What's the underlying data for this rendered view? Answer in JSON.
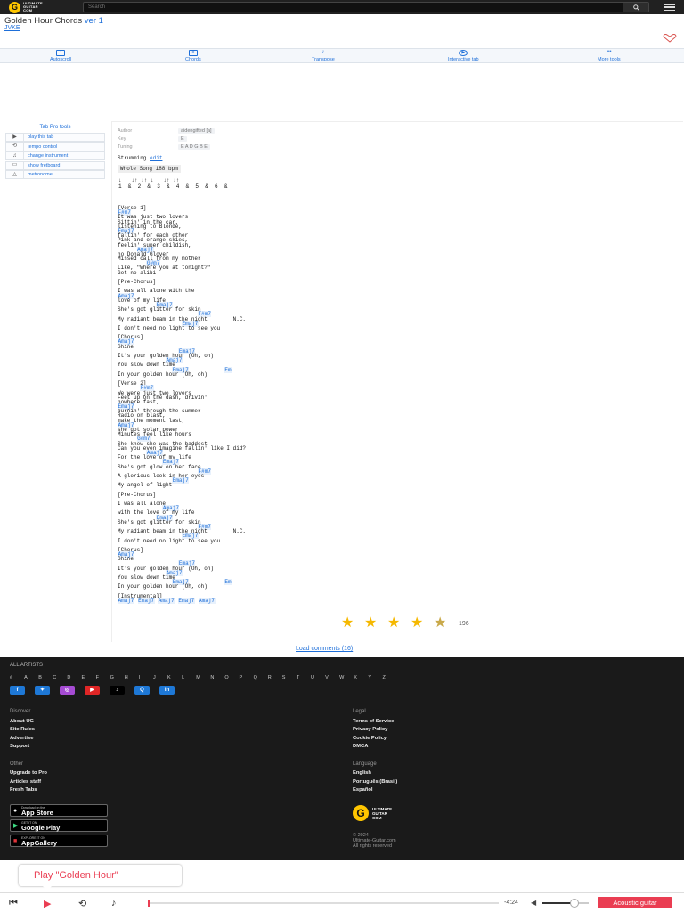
{
  "header": {
    "logo_lines": [
      "ULTIMATE",
      "GUITAR",
      "COM"
    ],
    "search_placeholder": "Search"
  },
  "song": {
    "title": "Golden Hour Chords",
    "version": "ver 1",
    "artist": "JVKE"
  },
  "toolbar": [
    "Autoscroll",
    "Chords",
    "Transpose",
    "Interactive tab",
    "More tools"
  ],
  "side_tools": {
    "header": "Tab Pro tools",
    "items": [
      "play this tab",
      "tempo control",
      "change instrument",
      "show fretboard",
      "metronome"
    ]
  },
  "meta": {
    "author_label": "Author",
    "author": "aidengifted [a]",
    "key_label": "Key",
    "key": "E",
    "tuning_label": "Tuning",
    "tuning": "E A D G B E"
  },
  "strumming": {
    "label": "Strumming",
    "edit": "edit",
    "pattern": "Whole Song   188 bpm",
    "counts": "1  &  2  &  3  &  4  &  5  &  6  &"
  },
  "tab_lines": [
    "[Verse 1]",
    "{F#m7}",
    "It was just two lovers",
    "Sittin' in the car,",
    "listening to Blonde,",
    "{Emaj7}",
    "fallin' for each other",
    "Pink and orange skies,",
    "feelin' super childish,",
    "      {Amaj7}",
    "no Donald Glover",
    "Missed call from my mother",
    "         {G#m7}",
    "Like, \"Where you at tonight?\"",
    "Got no alibi",
    "",
    "[Pre-Chorus]",
    "",
    "I was all alone with the",
    "{Amaj7}",
    "love of my life",
    "            {Emaj7}",
    "She's got glitter for skin",
    "                         {F#m7}",
    "My radiant beam in the night        N.C.",
    "                    {Emaj7}",
    "I don't need no light to see you",
    "",
    "[Chorus]",
    "{Amaj7}",
    "Shine",
    "                   {Emaj7}",
    "It's your golden hour (Oh, oh)",
    "               {Amaj7}",
    "You slow down time",
    "                 {Emaj7}           {Em}",
    "In your golden hour (Oh, oh)",
    "",
    "[Verse 2]",
    "       {F#m7}",
    "We were just two lovers",
    "Feet up on the dash, drivin'",
    "nowhere fast,",
    "{Emaj7}",
    "burnin' through the summer",
    "Radio on blast,",
    "make the moment last,",
    "{Amaj7}",
    "she got solar power",
    "Minutes feel like hours",
    "      {G#m7}",
    "She knew she was the baddest",
    "Can you even imagine fallin' like I did?",
    "         {Amaj7}",
    "For the love of my life",
    "              {Emaj7}",
    "She's got glow on her face",
    "                         {F#m7}",
    "A glorious look in her eyes",
    "                 {Emaj7}",
    "My angel of light",
    "",
    "[Pre-Chorus]",
    "",
    "I was all alone",
    "              {Amaj7}",
    "with the love of my life",
    "            {Emaj7}",
    "She's got glitter for skin",
    "                         {F#m7}",
    "My radiant beam in the night        N.C.",
    "                    {Emaj7}",
    "I don't need no light to see you",
    "",
    "[Chorus]",
    "{Amaj7}",
    "Shine",
    "                   {Emaj7}",
    "It's your golden hour (Oh, oh)",
    "               {Amaj7}",
    "You slow down time",
    "                 {Emaj7}           {Em}",
    "In your golden hour (Oh, oh)",
    "",
    "[Instrumental]",
    "{Amaj7} {Emaj7} {Amaj7} {Emaj7} {Amaj7}"
  ],
  "rating": {
    "stars": 4.5,
    "count": "196"
  },
  "load_comments": "Load comments (16)",
  "footer": {
    "all_artists": "ALL ARTISTS",
    "letters": [
      "#",
      "A",
      "B",
      "C",
      "D",
      "E",
      "F",
      "G",
      "H",
      "I",
      "J",
      "K",
      "L",
      "M",
      "N",
      "O",
      "P",
      "Q",
      "R",
      "S",
      "T",
      "U",
      "V",
      "W",
      "X",
      "Y",
      "Z"
    ],
    "socials": [
      "f",
      "t",
      "ig",
      "yt",
      "tt",
      "q",
      "in"
    ],
    "discover_title": "Discover",
    "discover": [
      "About UG",
      "Site Rules",
      "Advertise",
      "Support"
    ],
    "legal_title": "Legal",
    "legal": [
      "Terms of Service",
      "Privacy Policy",
      "Cookie Policy",
      "DMCA"
    ],
    "other_title": "Other",
    "other": [
      "Upgrade to Pro",
      "Articles staff",
      "Fresh Tabs"
    ],
    "language_title": "Language",
    "languages": [
      "English",
      "Português (Brasil)",
      "Español"
    ],
    "stores": [
      {
        "small": "Download on the",
        "name": "App Store"
      },
      {
        "small": "GET IT ON",
        "name": "Google Play"
      },
      {
        "small": "EXPLORE IT ON",
        "name": "AppGallery"
      }
    ],
    "copyright_lines": [
      "© 2024",
      "Ultimate-Guitar.com",
      "All rights reserved"
    ]
  },
  "player": {
    "popup": "Play \"Golden Hour\"",
    "time": "-4:24",
    "instrument": "Acoustic guitar",
    "progress": 0.0,
    "volume": 0.7
  },
  "colors": {
    "accent": "#1e6fd9",
    "brand_yellow": "#ffc600",
    "player_red": "#ea3d52",
    "footer_bg": "#1a1a1a"
  }
}
